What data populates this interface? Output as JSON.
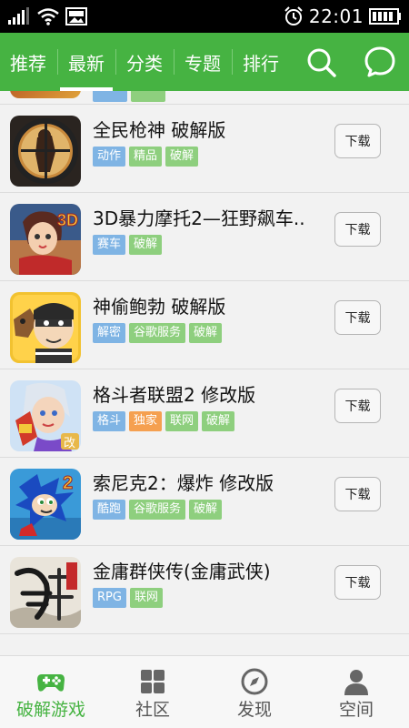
{
  "status_bar": {
    "time": "22:01",
    "icons": [
      "signal-icon",
      "wifi-icon",
      "photo-notification-icon",
      "alarm-icon",
      "battery-icon"
    ]
  },
  "top_nav": {
    "tabs": [
      {
        "label": "推荐"
      },
      {
        "label": "最新"
      },
      {
        "label": "分类"
      },
      {
        "label": "专题"
      },
      {
        "label": "排行"
      }
    ],
    "active_tab": "最新",
    "icons": [
      "search-icon",
      "message-icon"
    ]
  },
  "apps": [
    {
      "title": "全民枪神  破解版",
      "icon": "gun-shooter-game-icon",
      "tags": [
        {
          "label": "动作",
          "color": "#7fb4e4"
        },
        {
          "label": "精品",
          "color": "#8ecf7e"
        },
        {
          "label": "破解",
          "color": "#8ecf7e"
        }
      ],
      "button": "下载"
    },
    {
      "title": "3D暴力摩托2—狂野飙车..",
      "icon": "motorcycle-racing-game-icon",
      "tags": [
        {
          "label": "赛车",
          "color": "#7fb4e4"
        },
        {
          "label": "破解",
          "color": "#8ecf7e"
        }
      ],
      "button": "下载"
    },
    {
      "title": "神偷鲍勃  破解版",
      "icon": "thief-bob-game-icon",
      "tags": [
        {
          "label": "解密",
          "color": "#7fb4e4"
        },
        {
          "label": "谷歌服务",
          "color": "#8ecf7e"
        },
        {
          "label": "破解",
          "color": "#8ecf7e"
        }
      ],
      "button": "下载"
    },
    {
      "title": "格斗者联盟2  修改版",
      "icon": "fighter-league-game-icon",
      "tags": [
        {
          "label": "格斗",
          "color": "#7fb4e4"
        },
        {
          "label": "独家",
          "color": "#f5a050"
        },
        {
          "label": "联网",
          "color": "#8ecf7e"
        },
        {
          "label": "破解",
          "color": "#8ecf7e"
        }
      ],
      "button": "下载"
    },
    {
      "title": "索尼克2：爆炸  修改版",
      "icon": "sonic-game-icon",
      "tags": [
        {
          "label": "酷跑",
          "color": "#7fb4e4"
        },
        {
          "label": "谷歌服务",
          "color": "#8ecf7e"
        },
        {
          "label": "破解",
          "color": "#8ecf7e"
        }
      ],
      "button": "下载"
    },
    {
      "title": "金庸群侠传(金庸武侠)",
      "icon": "jin-yong-game-icon",
      "tags": [
        {
          "label": "RPG",
          "color": "#7fb4e4"
        },
        {
          "label": "联网",
          "color": "#8ecf7e"
        }
      ],
      "button": "下载"
    }
  ],
  "bottom_nav": [
    {
      "label": "破解游戏",
      "icon": "gamepad-icon",
      "active": true
    },
    {
      "label": "社区",
      "icon": "grid-icon",
      "active": false
    },
    {
      "label": "发现",
      "icon": "compass-icon",
      "active": false
    },
    {
      "label": "空间",
      "icon": "person-icon",
      "active": false
    }
  ],
  "colors": {
    "brand_green": "#46b342",
    "tag_blue": "#7fb4e4",
    "tag_green": "#8ecf7e",
    "tag_orange": "#f5a050"
  }
}
